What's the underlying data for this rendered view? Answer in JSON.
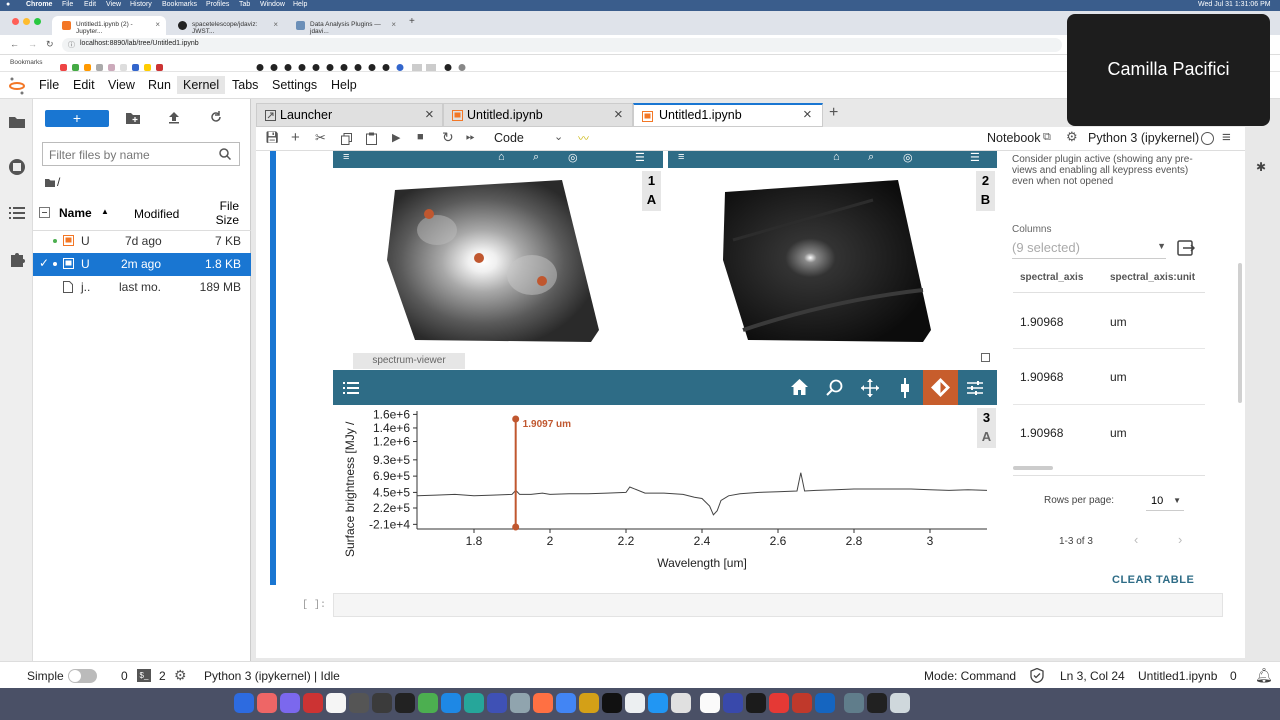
{
  "macos": {
    "menu": [
      "Chrome",
      "File",
      "Edit",
      "View",
      "History",
      "Bookmarks",
      "Profiles",
      "Tab",
      "Window",
      "Help"
    ],
    "clock": "Wed Jul 31  1:31:06 PM"
  },
  "browser": {
    "tabs": [
      {
        "label": "Untitled1.ipynb (2) - Jupyter...",
        "active": true
      },
      {
        "label": "spacetelescope/jdaviz: JWST...",
        "active": false
      },
      {
        "label": "Data Analysis Plugins — jdavi...",
        "active": false
      }
    ],
    "url": "localhost:8890/lab/tree/Untitled1.ipynb",
    "bookmarks_label": "Bookmarks"
  },
  "camera": {
    "name": "Camilla Pacifici"
  },
  "jupyter": {
    "menu": [
      "File",
      "Edit",
      "View",
      "Run",
      "Kernel",
      "Tabs",
      "Settings",
      "Help"
    ],
    "filebrowser": {
      "filter_placeholder": "Filter files by name",
      "path": "/",
      "headers": {
        "name": "Name",
        "modified": "Modified",
        "size": "File Size"
      },
      "rows": [
        {
          "name": "U",
          "modified": "7d ago",
          "size": "7 KB",
          "selected": false
        },
        {
          "name": "U",
          "modified": "2m ago",
          "size": "1.8 KB",
          "selected": true
        },
        {
          "name": "j..",
          "modified": "last mo.",
          "size": "189 MB",
          "selected": false
        }
      ]
    },
    "doc_tabs": [
      {
        "label": "Launcher",
        "active": false
      },
      {
        "label": "Untitled.ipynb",
        "active": false
      },
      {
        "label": "Untitled1.ipynb",
        "active": true
      }
    ],
    "notebook_toolbar": {
      "cell_type": "Code",
      "notebook_label": "Notebook",
      "kernel": "Python 3 (ipykernel)"
    },
    "viewers": {
      "image1": {
        "tag_num": "1",
        "tag_letter": "A"
      },
      "image2": {
        "tag_num": "2",
        "tag_letter": "B"
      },
      "spectrum": {
        "title": "spectrum-viewer",
        "tag_num": "3",
        "tag_letter": "A",
        "marker_label": "1.9097 um"
      }
    },
    "plugin": {
      "info_text": "Consider plugin active (showing any pre-views and enabling all keypress events) even when not opened",
      "columns_label": "Columns",
      "columns_value": "(9 selected)",
      "table_headers": [
        "spectral_axis",
        "spectral_axis:unit"
      ],
      "table_rows": [
        [
          "1.90968",
          "um"
        ],
        [
          "1.90968",
          "um"
        ],
        [
          "1.90968",
          "um"
        ]
      ],
      "rows_per_page_label": "Rows per page:",
      "rows_per_page": "10",
      "pagination": "1-3 of 3",
      "clear_label": "CLEAR TABLE"
    },
    "empty_cell_prompt": "[ ]:",
    "status": {
      "mode_label": "Simple",
      "count1": "0",
      "count2": "2",
      "kernel_status": "Python 3 (ipykernel) | Idle",
      "mode": "Mode: Command",
      "cursor": "Ln 3, Col 24",
      "file": "Untitled1.ipynb",
      "count3": "0"
    }
  },
  "chart_data": {
    "type": "line",
    "title": "",
    "xlabel": "Wavelength [um]",
    "ylabel": "Surface brightness [MJy /",
    "xlim": [
      1.65,
      3.15
    ],
    "ylim": [
      -210000,
      1600000
    ],
    "x_ticks": [
      "1.8",
      "2",
      "2.2",
      "2.4",
      "2.6",
      "2.8",
      "3"
    ],
    "y_ticks": [
      "1.6e+6",
      "1.4e+6",
      "1.2e+6",
      "9.3e+5",
      "6.9e+5",
      "4.5e+5",
      "2.2e+5",
      "-2.1e+4"
    ],
    "x_tick_values": [
      1.8,
      2.0,
      2.2,
      2.4,
      2.6,
      2.8,
      3.0
    ],
    "y_tick_values": [
      1600000,
      1400000,
      1200000,
      930000,
      690000,
      450000,
      220000,
      -21000
    ],
    "series": [
      {
        "x": [
          1.65,
          1.7,
          1.75,
          1.8,
          1.85,
          1.9,
          1.91,
          1.92,
          1.95,
          1.98,
          2.0,
          2.05,
          2.1,
          2.15,
          2.2,
          2.21,
          2.25,
          2.3,
          2.35,
          2.38,
          2.4,
          2.42,
          2.43,
          2.44,
          2.45,
          2.47,
          2.5,
          2.55,
          2.6,
          2.65,
          2.66,
          2.67,
          2.7,
          2.75,
          2.8,
          2.85,
          2.9,
          2.95,
          3.0,
          3.05,
          3.1,
          3.15
        ],
        "y": [
          400000,
          410000,
          420000,
          400000,
          410000,
          420000,
          480000,
          420000,
          420000,
          440000,
          420000,
          430000,
          430000,
          440000,
          450000,
          530000,
          440000,
          440000,
          420000,
          380000,
          360000,
          250000,
          120000,
          180000,
          330000,
          400000,
          430000,
          450000,
          460000,
          470000,
          740000,
          470000,
          480000,
          490000,
          500000,
          500000,
          500000,
          500000,
          490000,
          480000,
          490000,
          480000
        ]
      }
    ],
    "marker": {
      "x": 1.9097,
      "label": "1.9097 um"
    }
  }
}
